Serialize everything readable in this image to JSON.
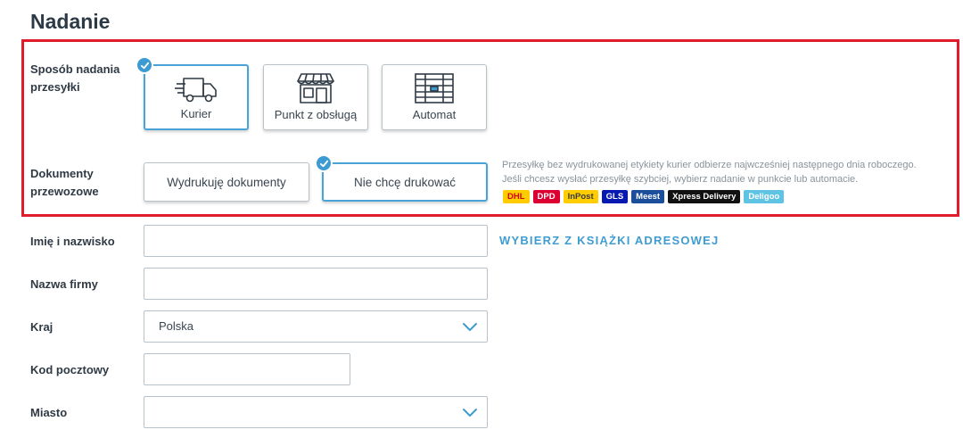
{
  "page": {
    "title": "Nadanie"
  },
  "shipping_method": {
    "label_line1": "Sposób nadania",
    "label_line2": "przesyłki",
    "options": [
      {
        "label": "Kurier",
        "icon": "truck-icon",
        "selected": true
      },
      {
        "label": "Punkt z obsługą",
        "icon": "shop-icon",
        "selected": false
      },
      {
        "label": "Automat",
        "icon": "parcel-locker-icon",
        "selected": false
      }
    ]
  },
  "documents": {
    "label_line1": "Dokumenty",
    "label_line2": "przewozowe",
    "options": [
      {
        "label": "Wydrukuję dokumenty",
        "selected": false
      },
      {
        "label": "Nie chcę drukować",
        "selected": true
      }
    ],
    "info_line1": "Przesyłkę bez wydrukowanej etykiety kurier odbierze najwcześniej następnego dnia roboczego.",
    "info_line2": "Jeśli chcesz wysłać przesyłkę szybciej, wybierz nadanie w punkcie lub automacie.",
    "carriers": [
      {
        "name": "DHL",
        "bg": "#ffcc00",
        "fg": "#d40511"
      },
      {
        "name": "DPD",
        "bg": "#dc0032",
        "fg": "#ffffff"
      },
      {
        "name": "InPost",
        "bg": "#ffcd00",
        "fg": "#3c3c3c"
      },
      {
        "name": "GLS",
        "bg": "#061ab1",
        "fg": "#ffffff"
      },
      {
        "name": "Meest",
        "bg": "#1b4f9c",
        "fg": "#ffffff"
      },
      {
        "name": "Xpress Delivery",
        "bg": "#111111",
        "fg": "#ffffff"
      },
      {
        "name": "Deligoo",
        "bg": "#5fc3e4",
        "fg": "#ffffff"
      }
    ]
  },
  "form": {
    "name_label": "Imię i nazwisko",
    "name_value": "",
    "address_book_link": "WYBIERZ Z KSIĄŻKI ADRESOWEJ",
    "company_label": "Nazwa firmy",
    "company_value": "",
    "country_label": "Kraj",
    "country_value": "Polska",
    "postal_label": "Kod pocztowy",
    "postal_value": "",
    "city_label": "Miasto",
    "city_value": ""
  },
  "colors": {
    "accent": "#3d9bd4",
    "highlight_border": "#e01b2b",
    "link": "#3f9cd0"
  }
}
